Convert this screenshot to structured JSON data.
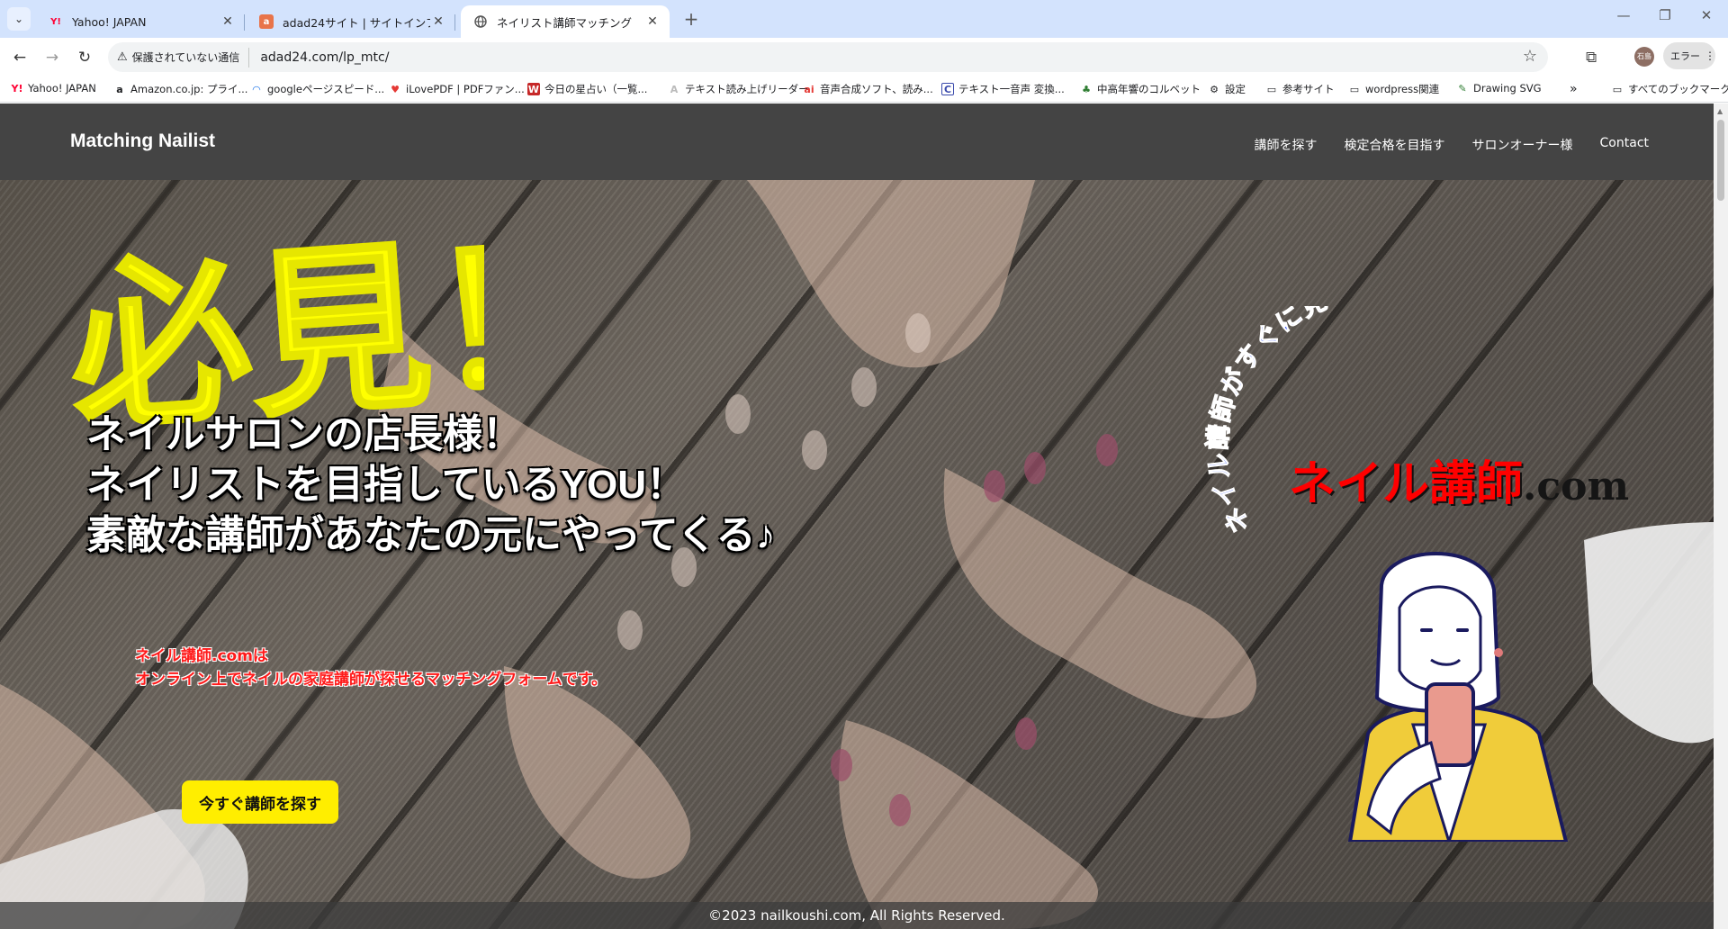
{
  "browser": {
    "tabs": [
      {
        "title": "Yahoo! JAPAN",
        "favicon": "Y!"
      },
      {
        "title": "adad24サイト | サイトインフォメーショ",
        "favicon": "a"
      },
      {
        "title": "ネイリスト講師マッチング",
        "favicon": "globe"
      }
    ],
    "security_label": "保護されていない通信",
    "url": "adad24.com/lp_mtc/",
    "profile_label": "石島",
    "error_button": "エラー",
    "bookmarks": [
      "Yahoo! JAPAN",
      "Amazon.co.jp: プライ...",
      "googleページスピード...",
      "iLovePDF | PDFファン...",
      "今日の星占い（一覧...",
      "テキスト読み上げリーダー",
      "音声合成ソフト、読み...",
      "テキスト一音声 変換...",
      "中高年響のコルベット",
      "設定",
      "参考サイト",
      "wordpress関連",
      "Drawing SVG"
    ],
    "all_bookmarks": "すべてのブックマーク"
  },
  "site": {
    "logo": "Matching Nailist",
    "nav": [
      "講師を探す",
      "検定合格を目指す",
      "サロンオーナー様",
      "Contact"
    ],
    "hero": {
      "headline_graphic": "必見！",
      "catch_lines": [
        "ネイルサロンの店長様！",
        "ネイリストを目指しているYOU！",
        "素敵な講師があなたの元にやってくる♪"
      ],
      "desc_lines": [
        "ネイル講師.comは",
        "オンライン上でネイルの家庭講師が探せるマッチングフォームです。"
      ],
      "cta": "今すぐ講師を探す",
      "arc_text": "ネイル講師がすぐに見つかる！",
      "brand_main": "ネイル講師",
      "brand_suffix": ".com"
    },
    "footer": "©2023 nailkoushi.com, All Rights Reserved."
  },
  "colors": {
    "header_bg": "#444444",
    "cta_bg": "#ffee00",
    "desc_red": "#ff1a1a",
    "brand_red": "#ff0000",
    "arc_blue": "#1a3cff"
  }
}
